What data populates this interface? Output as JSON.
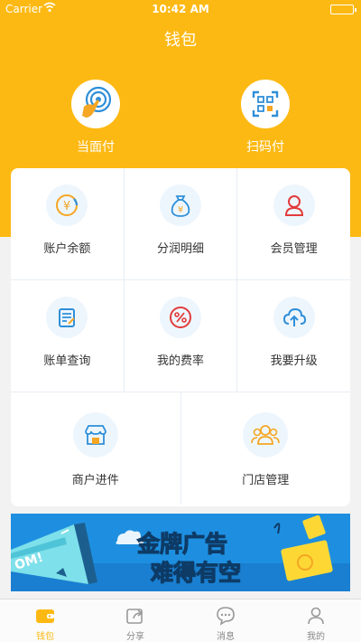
{
  "status_bar": {
    "carrier": "Carrier",
    "time": "10:42 AM"
  },
  "nav": {
    "title": "钱包"
  },
  "quick_actions": [
    {
      "label": "当面付",
      "icon": "hand-tap-icon"
    },
    {
      "label": "扫码付",
      "icon": "qr-scan-icon"
    }
  ],
  "grid": {
    "row1": [
      {
        "label": "账户余额",
        "icon": "yuan-coin-icon"
      },
      {
        "label": "分润明细",
        "icon": "money-bag-icon"
      },
      {
        "label": "会员管理",
        "icon": "user-icon"
      }
    ],
    "row2": [
      {
        "label": "账单查询",
        "icon": "bill-icon"
      },
      {
        "label": "我的费率",
        "icon": "rate-icon"
      },
      {
        "label": "我要升级",
        "icon": "cloud-upload-icon"
      }
    ],
    "row3": [
      {
        "label": "商户进件",
        "icon": "store-icon"
      },
      {
        "label": "门店管理",
        "icon": "group-icon"
      }
    ]
  },
  "banner": {
    "line1": "金牌广告",
    "line2": "难得有空",
    "megaphone_text": "OM!"
  },
  "tabbar": [
    {
      "label": "钱包",
      "icon": "wallet-icon",
      "active": true
    },
    {
      "label": "分享",
      "icon": "share-icon",
      "active": false
    },
    {
      "label": "消息",
      "icon": "message-icon",
      "active": false
    },
    {
      "label": "我的",
      "icon": "profile-icon",
      "active": false
    }
  ],
  "colors": {
    "primary": "#fdb913",
    "icon_blue": "#2f8fd8",
    "icon_red": "#e23b3b",
    "banner_blue": "#1e8fe0"
  }
}
